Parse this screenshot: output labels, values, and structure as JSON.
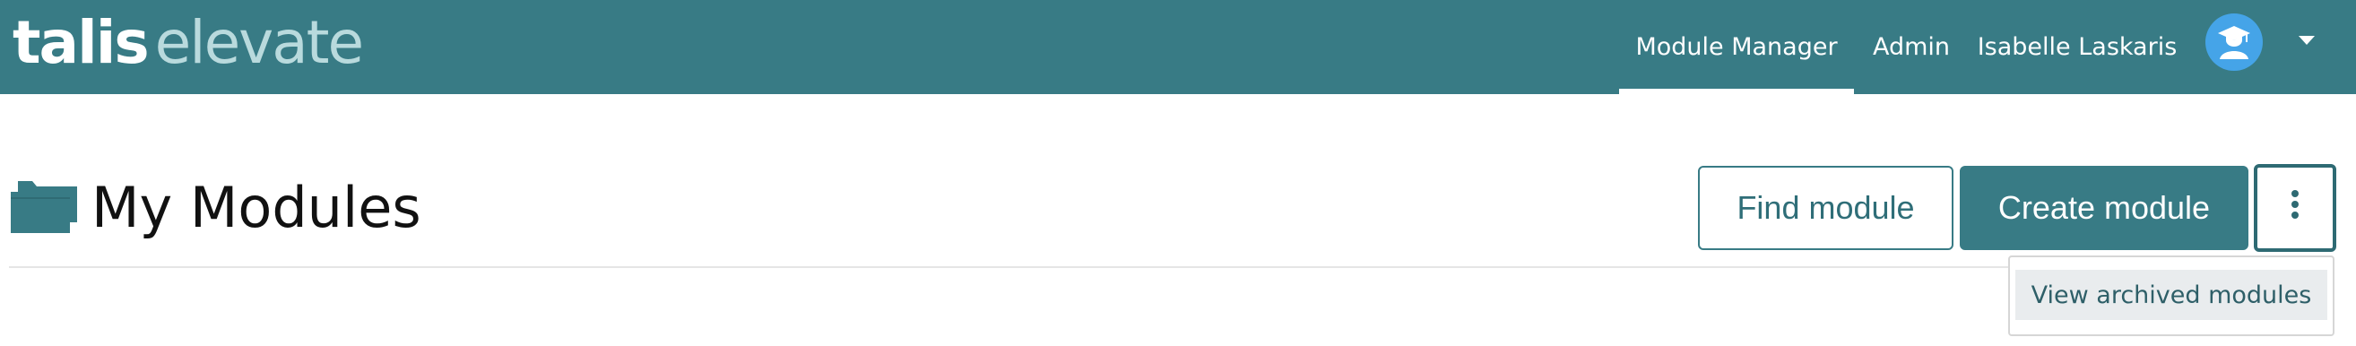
{
  "brand": {
    "logo_primary": "talis",
    "logo_secondary": "elevate"
  },
  "nav": {
    "items": [
      {
        "label": "Module Manager",
        "active": true
      },
      {
        "label": "Admin",
        "active": false
      },
      {
        "label": "Isabelle Laskaris",
        "active": false
      }
    ],
    "avatar_icon": "graduate-user-icon",
    "menu_icon": "chevron-down-icon"
  },
  "page": {
    "title": "My Modules",
    "title_icon": "folder-icon"
  },
  "actions": {
    "find_label": "Find module",
    "create_label": "Create module",
    "more_icon": "more-vertical-icon"
  },
  "dropdown": {
    "items": [
      {
        "label": "View archived modules"
      }
    ]
  },
  "colors": {
    "brand": "#387b85",
    "avatar": "#45a4e8",
    "logo_light": "#b9dadd",
    "dropdown_hover": "#e9ecee"
  }
}
